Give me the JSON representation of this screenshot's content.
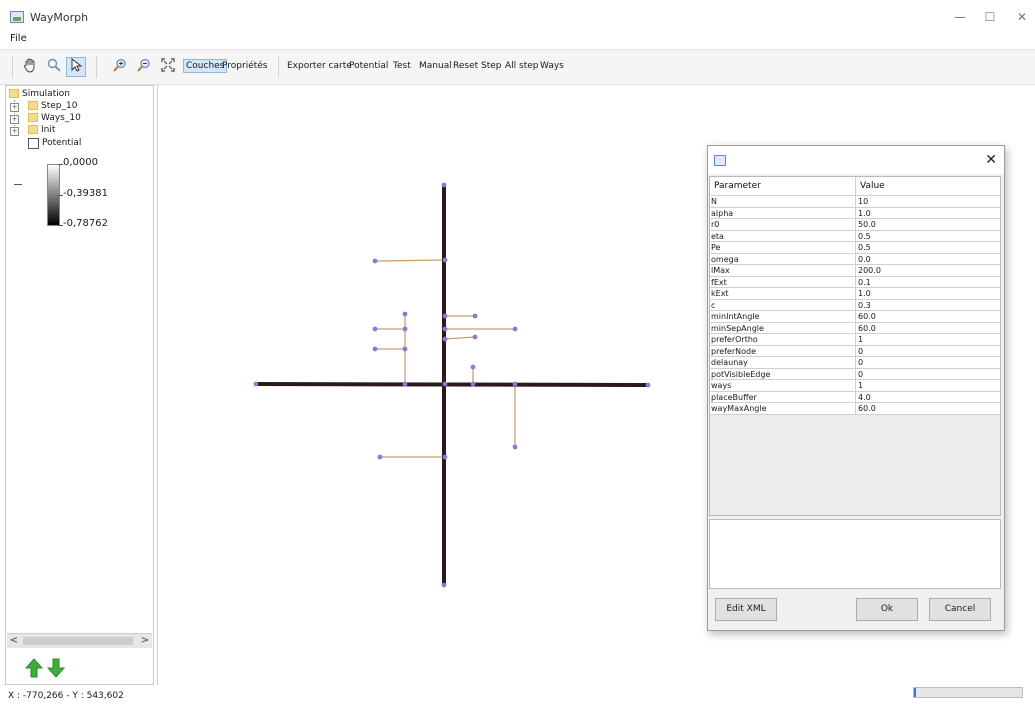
{
  "window": {
    "title": "WayMorph",
    "minimize": "—",
    "maximize": "☐",
    "close": "✕"
  },
  "menu": {
    "file": "File"
  },
  "toolbar": {
    "pan_icon": "hand-icon",
    "zoom_icon": "magnifier-icon",
    "select_icon": "pointer-icon",
    "zoom_in_icon": "zoom-in-icon",
    "zoom_out_icon": "zoom-out-icon",
    "fit_icon": "fit-extent-icon",
    "couches": "Couches",
    "proprietes": "Propriétés",
    "exporter": "Exporter carte",
    "potential": "Potential",
    "test": "Test",
    "manual": "Manual",
    "reset": "Reset",
    "step": "Step",
    "all_step": "All step",
    "ways": "Ways"
  },
  "sidebar": {
    "tree": {
      "root": "Simulation",
      "items": [
        {
          "label": "Step_10"
        },
        {
          "label": "Ways_10"
        },
        {
          "label": "Init"
        }
      ],
      "potential": "Potential"
    },
    "legend": {
      "max": "0,0000",
      "mid": "-0,39381",
      "min": "-0,78762"
    },
    "scroll_left": "<",
    "scroll_right": ">"
  },
  "dialog": {
    "columns": {
      "param": "Parameter",
      "value": "Value"
    },
    "rows": [
      {
        "name": "N",
        "value": "10"
      },
      {
        "name": "alpha",
        "value": "1.0"
      },
      {
        "name": "r0",
        "value": "50.0"
      },
      {
        "name": "eta",
        "value": "0.5"
      },
      {
        "name": "Pe",
        "value": "0.5"
      },
      {
        "name": "omega",
        "value": "0.0"
      },
      {
        "name": "lMax",
        "value": "200.0"
      },
      {
        "name": "fExt",
        "value": "0.1"
      },
      {
        "name": "kExt",
        "value": "1.0"
      },
      {
        "name": "c",
        "value": "0.3"
      },
      {
        "name": "minIntAngle",
        "value": "60.0"
      },
      {
        "name": "minSepAngle",
        "value": "60.0"
      },
      {
        "name": "preferOrtho",
        "value": "1"
      },
      {
        "name": "preferNode",
        "value": "0"
      },
      {
        "name": "delaunay",
        "value": "0"
      },
      {
        "name": "potVisibleEdge",
        "value": "0"
      },
      {
        "name": "ways",
        "value": "1"
      },
      {
        "name": "placeBuffer",
        "value": "4.0"
      },
      {
        "name": "wayMaxAngle",
        "value": "60.0"
      }
    ],
    "close": "✕",
    "edit_xml": "Edit XML",
    "ok": "Ok",
    "cancel": "Cancel"
  },
  "status": {
    "coords": "X : -770,266 - Y : 543,602"
  },
  "colors": {
    "road": "#2a1a1a",
    "branch": "#c8a070",
    "node": "#8a79d6"
  }
}
